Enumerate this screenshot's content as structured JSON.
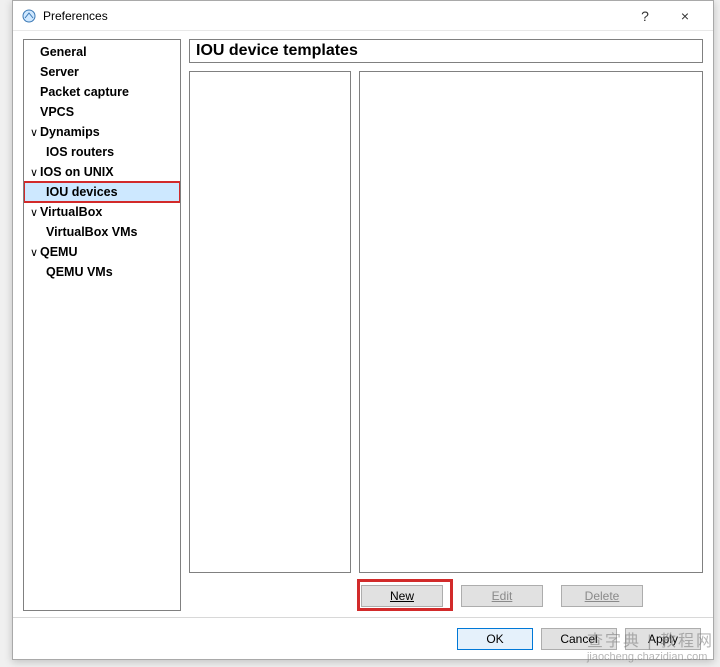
{
  "window": {
    "title": "Preferences",
    "help_symbol": "?",
    "close_symbol": "×"
  },
  "tree": {
    "items": [
      {
        "label": "General",
        "level": 0,
        "expander": ""
      },
      {
        "label": "Server",
        "level": 0,
        "expander": ""
      },
      {
        "label": "Packet capture",
        "level": 0,
        "expander": ""
      },
      {
        "label": "VPCS",
        "level": 0,
        "expander": ""
      },
      {
        "label": "Dynamips",
        "level": 0,
        "expander": "∨"
      },
      {
        "label": "IOS routers",
        "level": 1,
        "expander": ""
      },
      {
        "label": "IOS on UNIX",
        "level": 0,
        "expander": "∨"
      },
      {
        "label": "IOU devices",
        "level": 1,
        "expander": "",
        "selected": true
      },
      {
        "label": "VirtualBox",
        "level": 0,
        "expander": "∨"
      },
      {
        "label": "VirtualBox VMs",
        "level": 1,
        "expander": ""
      },
      {
        "label": "QEMU",
        "level": 0,
        "expander": "∨"
      },
      {
        "label": "QEMU VMs",
        "level": 1,
        "expander": ""
      }
    ]
  },
  "main": {
    "heading": "IOU device templates",
    "buttons": {
      "new": "New",
      "edit": "Edit",
      "delete": "Delete"
    }
  },
  "dialog_buttons": {
    "ok": "OK",
    "cancel": "Cancel",
    "apply": "Apply"
  },
  "watermark": {
    "line1": "查字典 | 教程网",
    "line2": "jiaocheng.chazidian.com"
  }
}
